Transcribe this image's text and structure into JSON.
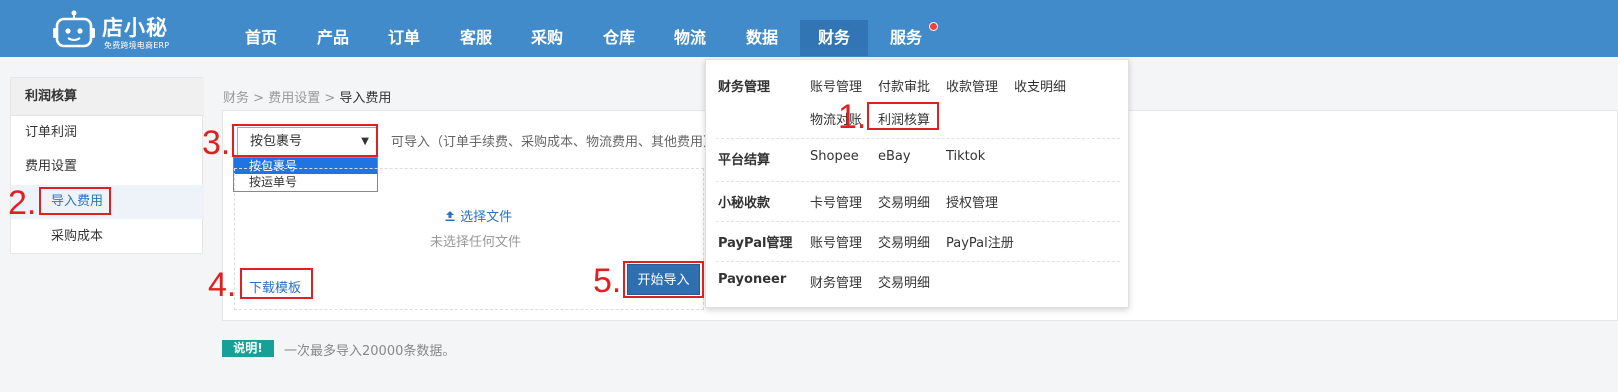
{
  "logo": {
    "brand": "店小秘",
    "tagline": "免费跨境电商ERP"
  },
  "nav": {
    "items": [
      {
        "label": "首页"
      },
      {
        "label": "产品"
      },
      {
        "label": "订单"
      },
      {
        "label": "客服"
      },
      {
        "label": "采购"
      },
      {
        "label": "仓库"
      },
      {
        "label": "物流"
      },
      {
        "label": "数据"
      },
      {
        "label": "财务"
      },
      {
        "label": "服务"
      }
    ]
  },
  "sidebar": {
    "title": "利润核算",
    "items": [
      {
        "label": "订单利润"
      },
      {
        "label": "费用设置"
      },
      {
        "label": "导入费用"
      },
      {
        "label": "采购成本"
      }
    ]
  },
  "breadcrumb": {
    "part1": "财务",
    "sep": ">",
    "part2": "费用设置",
    "current": "导入费用"
  },
  "importer": {
    "select_value": "按包裹号",
    "options": [
      "按包裹号",
      "按运单号"
    ],
    "hint": "可导入（订单手续费、采购成本、物流费用、其他费用）",
    "choose_file": "选择文件",
    "no_file": "未选择任何文件",
    "download_template": "下载模板",
    "start_import": "开始导入"
  },
  "note": {
    "badge": "说明!",
    "text": "一次最多导入20000条数据。"
  },
  "mega_menu": {
    "sections": [
      {
        "title": "财务管理",
        "links": [
          "账号管理",
          "付款审批",
          "收款管理",
          "收支明细",
          "物流对账",
          "利润核算"
        ]
      },
      {
        "title": "平台结算",
        "links": [
          "Shopee",
          "eBay",
          "Tiktok"
        ]
      },
      {
        "title": "小秘收款",
        "links": [
          "卡号管理",
          "交易明细",
          "授权管理"
        ]
      },
      {
        "title": "PayPal管理",
        "links": [
          "账号管理",
          "交易明细",
          "PayPal注册"
        ]
      },
      {
        "title": "Payoneer",
        "links": [
          "财务管理",
          "交易明细"
        ]
      }
    ]
  },
  "annotations": [
    "1.",
    "2.",
    "3.",
    "4.",
    "5."
  ],
  "colors": {
    "nav_bg": "#428bca",
    "accent": "#2b72c2",
    "annotation": "#e02020",
    "note_badge": "#17a097"
  }
}
